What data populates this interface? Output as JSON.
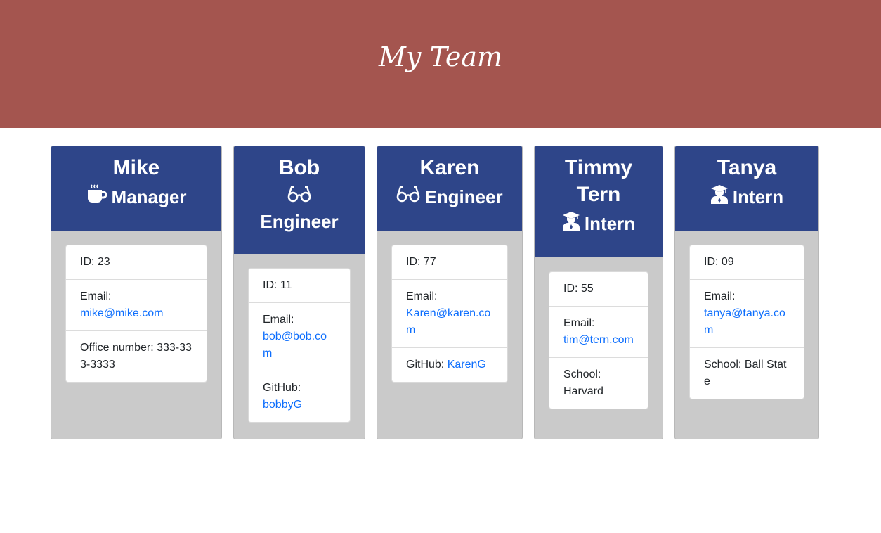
{
  "header": {
    "title": "My Team"
  },
  "colors": {
    "header_bg": "#a4554f",
    "card_header_bg": "#2e4589",
    "card_body_bg": "#cacaca",
    "link": "#0d6efd"
  },
  "cards": [
    {
      "name": "Mike",
      "role": "Manager",
      "role_icon": "coffee-mug-icon",
      "id_label": "ID:",
      "id": "23",
      "email_label": "Email:",
      "email": "mike@mike.com",
      "extra_label": "Office number:",
      "extra_value": "333-333-3333"
    },
    {
      "name": "Bob",
      "role": "Engineer",
      "role_icon": "glasses-icon",
      "id_label": "ID:",
      "id": "11",
      "email_label": "Email:",
      "email": "bob@bob.com",
      "extra_label": "GitHub:",
      "extra_value": "bobbyG"
    },
    {
      "name": "Karen",
      "role": "Engineer",
      "role_icon": "glasses-icon",
      "id_label": "ID:",
      "id": "77",
      "email_label": "Email:",
      "email": "Karen@karen.com",
      "extra_label": "GitHub:",
      "extra_value": "KarenG"
    },
    {
      "name": "Timmy Tern",
      "role": "Intern",
      "role_icon": "graduate-icon",
      "id_label": "ID:",
      "id": "55",
      "email_label": "Email:",
      "email": "tim@tern.com",
      "extra_label": "School:",
      "extra_value": "Harvard"
    },
    {
      "name": "Tanya",
      "role": "Intern",
      "role_icon": "graduate-icon",
      "id_label": "ID:",
      "id": "09",
      "email_label": "Email:",
      "email": "tanya@tanya.com",
      "extra_label": "School:",
      "extra_value": "Ball State"
    }
  ]
}
